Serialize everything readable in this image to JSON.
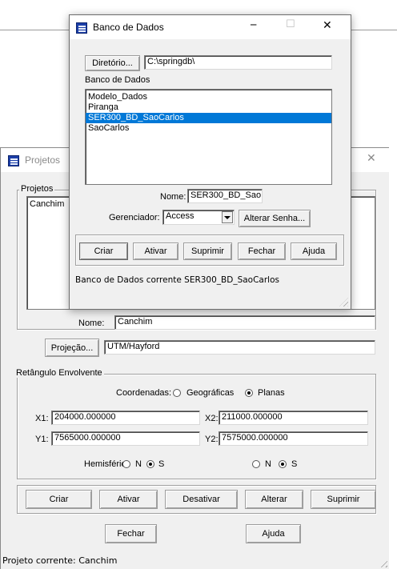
{
  "projetos_window": {
    "title": "Projetos",
    "group_projetos": "Projetos",
    "list": [
      "Canchim"
    ],
    "nome_label": "Nome:",
    "nome_value": "Canchim",
    "projecao_button": "Projeção...",
    "projecao_value": "UTM/Hayford",
    "group_retangulo": "Retângulo Envolvente",
    "coordenadas_label": "Coordenadas:",
    "geograficas_label": "Geográficas",
    "planas_label": "Planas",
    "x1_label": "X1:",
    "x1_value": "204000.000000",
    "x2_label": "X2:",
    "x2_value": "211000.000000",
    "y1_label": "Y1:",
    "y1_value": "7565000.000000",
    "y2_label": "Y2:",
    "y2_value": "7575000.000000",
    "hemisferio_label": "Hemisfério:",
    "n_label": "N",
    "s_label": "S",
    "buttons": {
      "criar": "Criar",
      "ativar": "Ativar",
      "desativar": "Desativar",
      "alterar": "Alterar",
      "suprimir": "Suprimir",
      "fechar": "Fechar",
      "ajuda": "Ajuda"
    },
    "status": "Projeto corrente: Canchim"
  },
  "banco_window": {
    "title": "Banco de Dados",
    "minimize": "─",
    "maximize": "☐",
    "close": "✕",
    "diretorio_button": "Diretório...",
    "diretorio_value": "C:\\springdb\\",
    "list_label": "Banco de Dados",
    "list": [
      "Modelo_Dados",
      "Piranga",
      "SER300_BD_SaoCarlos",
      "SaoCarlos"
    ],
    "selected_index": 2,
    "nome_label": "Nome:",
    "nome_value": "SER300_BD_Sao",
    "gerenciador_label": "Gerenciador:",
    "gerenciador_value": "Access",
    "alterar_senha_button": "Alterar Senha...",
    "buttons": {
      "criar": "Criar",
      "ativar": "Ativar",
      "suprimir": "Suprimir",
      "fechar": "Fechar",
      "ajuda": "Ajuda"
    },
    "status": "Banco de Dados corrente SER300_BD_SaoCarlos"
  },
  "colors": {
    "selection": "#0078d7",
    "window_bg": "#f0f0f0"
  }
}
